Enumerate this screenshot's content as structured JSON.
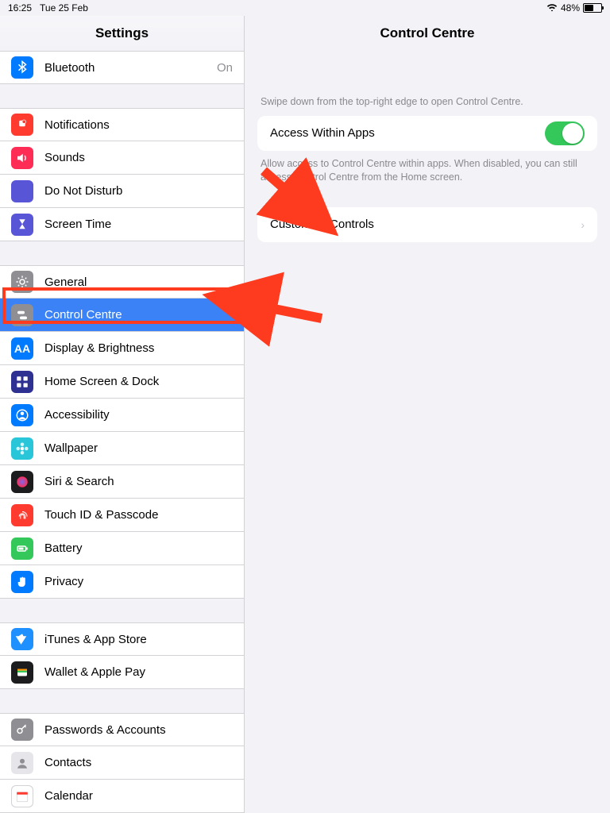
{
  "statusbar": {
    "time": "16:25",
    "date": "Tue 25 Feb",
    "battery_pct": "48%"
  },
  "sidebar": {
    "title": "Settings",
    "groups": [
      {
        "items": [
          {
            "id": "bluetooth",
            "label": "Bluetooth",
            "value": "On",
            "icon_bg": "#007aff",
            "glyph": "bt"
          }
        ]
      },
      {
        "items": [
          {
            "id": "notifications",
            "label": "Notifications",
            "icon_bg": "#ff3b30",
            "glyph": "bell"
          },
          {
            "id": "sounds",
            "label": "Sounds",
            "icon_bg": "#ff2d55",
            "glyph": "speaker"
          },
          {
            "id": "dnd",
            "label": "Do Not Disturb",
            "icon_bg": "#5856d6",
            "glyph": "moon"
          },
          {
            "id": "screentime",
            "label": "Screen Time",
            "icon_bg": "#5856d6",
            "glyph": "hourglass"
          }
        ]
      },
      {
        "items": [
          {
            "id": "general",
            "label": "General",
            "icon_bg": "#8e8e93",
            "glyph": "gear"
          },
          {
            "id": "controlcentre",
            "label": "Control Centre",
            "icon_bg": "#8e8e93",
            "glyph": "switches",
            "selected": true
          },
          {
            "id": "display",
            "label": "Display & Brightness",
            "icon_bg": "#007aff",
            "glyph": "AA"
          },
          {
            "id": "homescreen",
            "label": "Home Screen & Dock",
            "icon_bg": "#2e3192",
            "glyph": "grid"
          },
          {
            "id": "accessibility",
            "label": "Accessibility",
            "icon_bg": "#007aff",
            "glyph": "person"
          },
          {
            "id": "wallpaper",
            "label": "Wallpaper",
            "icon_bg": "#29c5d8",
            "glyph": "flower"
          },
          {
            "id": "siri",
            "label": "Siri & Search",
            "icon_bg": "#1c1c1e",
            "glyph": "siri"
          },
          {
            "id": "touchid",
            "label": "Touch ID & Passcode",
            "icon_bg": "#ff3b30",
            "glyph": "finger"
          },
          {
            "id": "battery",
            "label": "Battery",
            "icon_bg": "#34c759",
            "glyph": "battery"
          },
          {
            "id": "privacy",
            "label": "Privacy",
            "icon_bg": "#007aff",
            "glyph": "hand"
          }
        ]
      },
      {
        "items": [
          {
            "id": "itunes",
            "label": "iTunes & App Store",
            "icon_bg": "#1e90ff",
            "glyph": "appstore"
          },
          {
            "id": "wallet",
            "label": "Wallet & Apple Pay",
            "icon_bg": "#1c1c1e",
            "glyph": "wallet"
          }
        ]
      },
      {
        "items": [
          {
            "id": "passwords",
            "label": "Passwords & Accounts",
            "icon_bg": "#8e8e93",
            "glyph": "key"
          },
          {
            "id": "contacts",
            "label": "Contacts",
            "icon_bg": "#c7c7cc",
            "glyph": "contact"
          },
          {
            "id": "calendar",
            "label": "Calendar",
            "icon_bg": "#ffffff",
            "glyph": "cal"
          }
        ]
      }
    ]
  },
  "detail": {
    "title": "Control Centre",
    "hint_top": "Swipe down from the top-right edge to open Control Centre.",
    "access_label": "Access Within Apps",
    "access_on": true,
    "hint_mid": "Allow access to Control Centre within apps. When disabled, you can still access Control Centre from the Home screen.",
    "customise_label": "Customise Controls"
  }
}
